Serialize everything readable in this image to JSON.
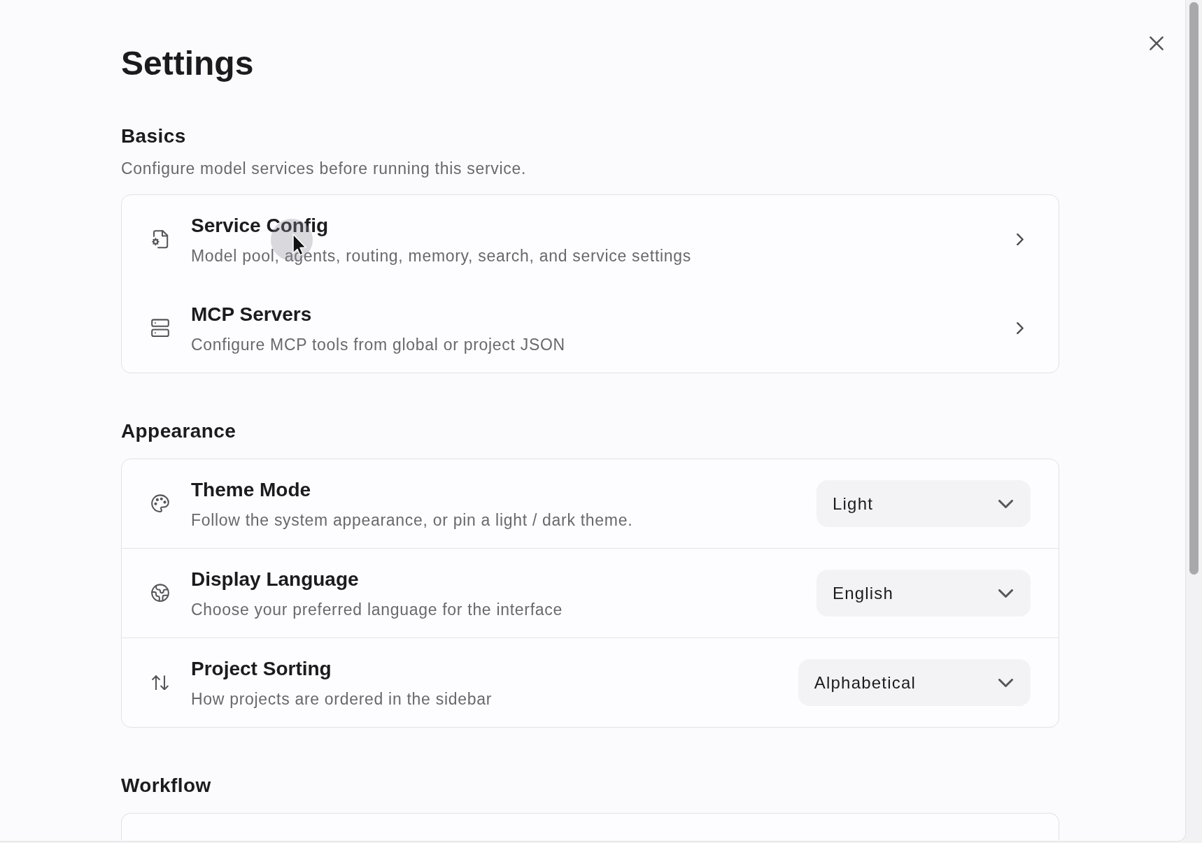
{
  "title": "Settings",
  "sections": [
    {
      "heading": "Basics",
      "description": "Configure model services before running this service.",
      "items": [
        {
          "kind": "link",
          "title": "Service Config",
          "subtitle": "Model pool, agents, routing, memory, search, and service settings"
        },
        {
          "kind": "link",
          "title": "MCP Servers",
          "subtitle": "Configure MCP tools from global or project JSON"
        }
      ]
    },
    {
      "heading": "Appearance",
      "items": [
        {
          "kind": "select",
          "title": "Theme Mode",
          "subtitle": "Follow the system appearance, or pin a light / dark theme.",
          "value": "Light"
        },
        {
          "kind": "select",
          "title": "Display Language",
          "subtitle": "Choose your preferred language for the interface",
          "value": "English"
        },
        {
          "kind": "select",
          "title": "Project Sorting",
          "subtitle": "How projects are ordered in the sidebar",
          "value": "Alphabetical"
        }
      ]
    },
    {
      "heading": "Workflow"
    }
  ]
}
